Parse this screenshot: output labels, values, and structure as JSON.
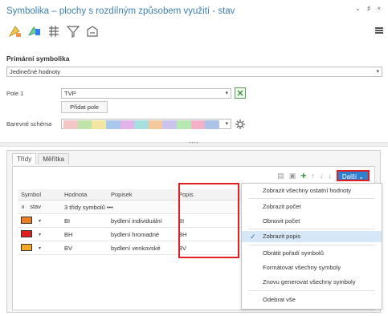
{
  "window": {
    "title": "Symbolika – plochy s rozdílným způsobem využití - stav",
    "controls": "⌄ ♯ ×"
  },
  "primary": {
    "section_title": "Primární symbolika",
    "renderer": "Jedinečné hodnoty",
    "field_label": "Pole 1",
    "field_value": "TVP",
    "add_field_button": "Přidat pole",
    "color_scheme_label": "Barevné schéma",
    "color_scheme_colors": [
      "#f5c6c6",
      "#bfe3a8",
      "#f3e6a1",
      "#a9c8ec",
      "#e2b4e8",
      "#a6dfe0",
      "#f3c89c",
      "#c9c3ee",
      "#b8e8b1",
      "#f2b1c8",
      "#aac3e7"
    ]
  },
  "tabs": [
    {
      "label": "Třídy"
    },
    {
      "label": "Měřítka"
    }
  ],
  "actions": {
    "more_label": "Další ⌄"
  },
  "table": {
    "headers": {
      "symbol": "Symbol",
      "value": "Hodnota",
      "label": "Popisek",
      "description": "Popis"
    },
    "group": {
      "field": "stav",
      "classes": "3 třídy symbolů •••"
    },
    "rows": [
      {
        "value": "BI",
        "label": "bydlení individuální",
        "description": "BI",
        "color": "#f07c22"
      },
      {
        "value": "BH",
        "label": "bydlení hromadné",
        "description": "BH",
        "color": "#e02020"
      },
      {
        "value": "BV",
        "label": "bydlení venkovské",
        "description": "BV",
        "color": "#f6a623"
      }
    ]
  },
  "menu": {
    "items": [
      {
        "label": "Zobrazit všechny ostatní hodnoty"
      },
      {
        "label": "Zobrazit počet"
      },
      {
        "label": "Obnovit počet"
      },
      {
        "label": "Zobrazit popis",
        "checked": true
      },
      {
        "label": "Obrátit pořadí symbolů"
      },
      {
        "label": "Formátovat všechny symboly"
      },
      {
        "label": "Znovu generovat všechny symboly"
      },
      {
        "label": "Odebrat vše"
      }
    ]
  },
  "colors": {
    "accent": "#2f7fd0",
    "highlight": "#e02020",
    "selected_item": "#d6e8f7"
  }
}
